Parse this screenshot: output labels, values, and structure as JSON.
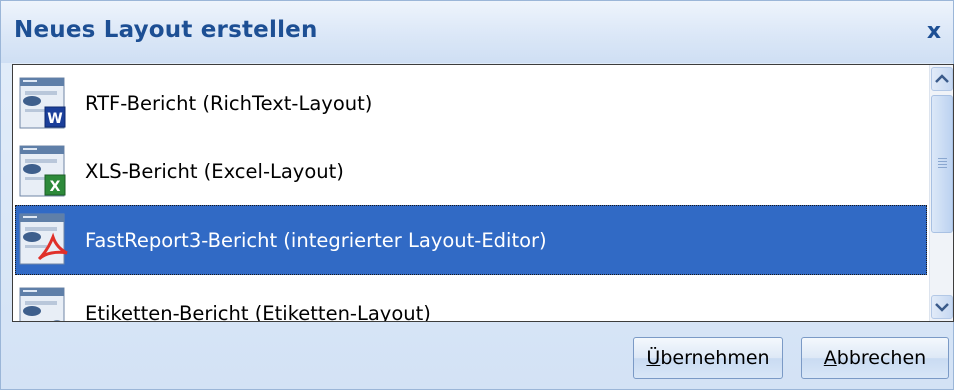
{
  "window": {
    "title": "Neues Layout erstellen",
    "close_label": "x"
  },
  "list": {
    "items": [
      {
        "label": "RTF-Bericht (RichText-Layout)",
        "icon": "word-document-icon",
        "selected": false
      },
      {
        "label": "XLS-Bericht (Excel-Layout)",
        "icon": "excel-document-icon",
        "selected": false
      },
      {
        "label": "FastReport3-Bericht (integrierter Layout-Editor)",
        "icon": "pdf-document-icon",
        "selected": true
      },
      {
        "label": "Etiketten-Bericht (Etiketten-Layout)",
        "icon": "label-document-icon",
        "selected": false
      }
    ]
  },
  "buttons": {
    "apply_accel": "Ü",
    "apply_rest": "bernehmen",
    "cancel_accel": "A",
    "cancel_rest": "bbrechen"
  },
  "colors": {
    "selection": "#316ac5",
    "title_text": "#1d4f94"
  }
}
